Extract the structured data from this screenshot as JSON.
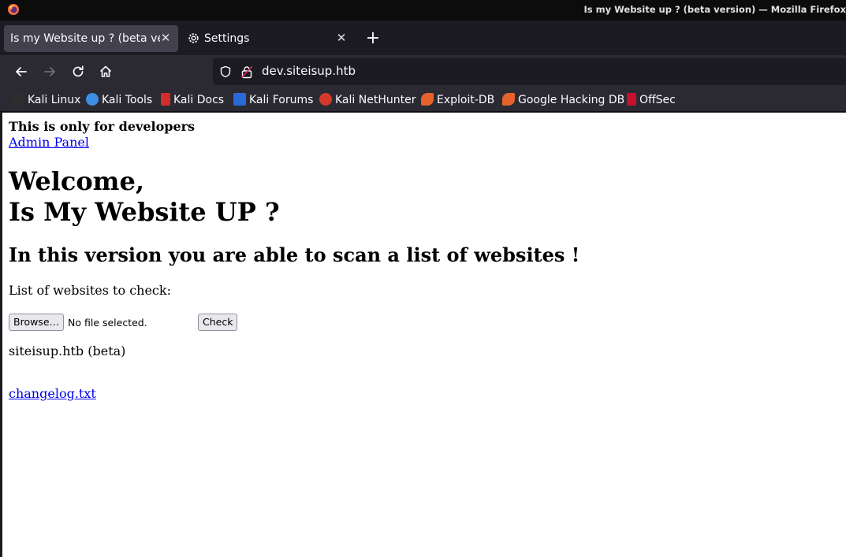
{
  "window": {
    "title": "Is my Website up ? (beta version) — Mozilla Firefox"
  },
  "tabs": [
    {
      "label": "Is my Website up ? (beta version)",
      "active": true
    },
    {
      "label": "Settings",
      "active": false
    }
  ],
  "navbar": {
    "url": "dev.siteisup.htb"
  },
  "bookmarks": [
    {
      "label": "Kali Linux",
      "icon": "kali-dragon-icon",
      "color": "#2d2d2d"
    },
    {
      "label": "Kali Tools",
      "icon": "kali-tools-icon",
      "color": "#3d8ee6"
    },
    {
      "label": "Kali Docs",
      "icon": "kali-docs-icon",
      "color": "#d42b2b"
    },
    {
      "label": "Kali Forums",
      "icon": "kali-forums-icon",
      "color": "#2a6ad6"
    },
    {
      "label": "Kali NetHunter",
      "icon": "nethunter-icon",
      "color": "#d33a2c"
    },
    {
      "label": "Exploit-DB",
      "icon": "exploit-db-icon",
      "color": "#e8622c"
    },
    {
      "label": "Google Hacking DB",
      "icon": "ghdb-icon",
      "color": "#e8622c"
    },
    {
      "label": "OffSec",
      "icon": "offsec-icon",
      "color": "#c8102e"
    }
  ],
  "page": {
    "dev_note": "This is only for developers",
    "admin_link": "Admin Panel",
    "welcome_line1": "Welcome,",
    "welcome_line2": "Is My Website UP ?",
    "subheading": "In this version you are able to scan a list of websites !",
    "list_label": "List of websites to check:",
    "browse_label": "Browse…",
    "no_file_text": "No file selected.",
    "check_label": "Check",
    "footer_text": "siteisup.htb (beta)",
    "changelog_link": "changelog.txt"
  }
}
